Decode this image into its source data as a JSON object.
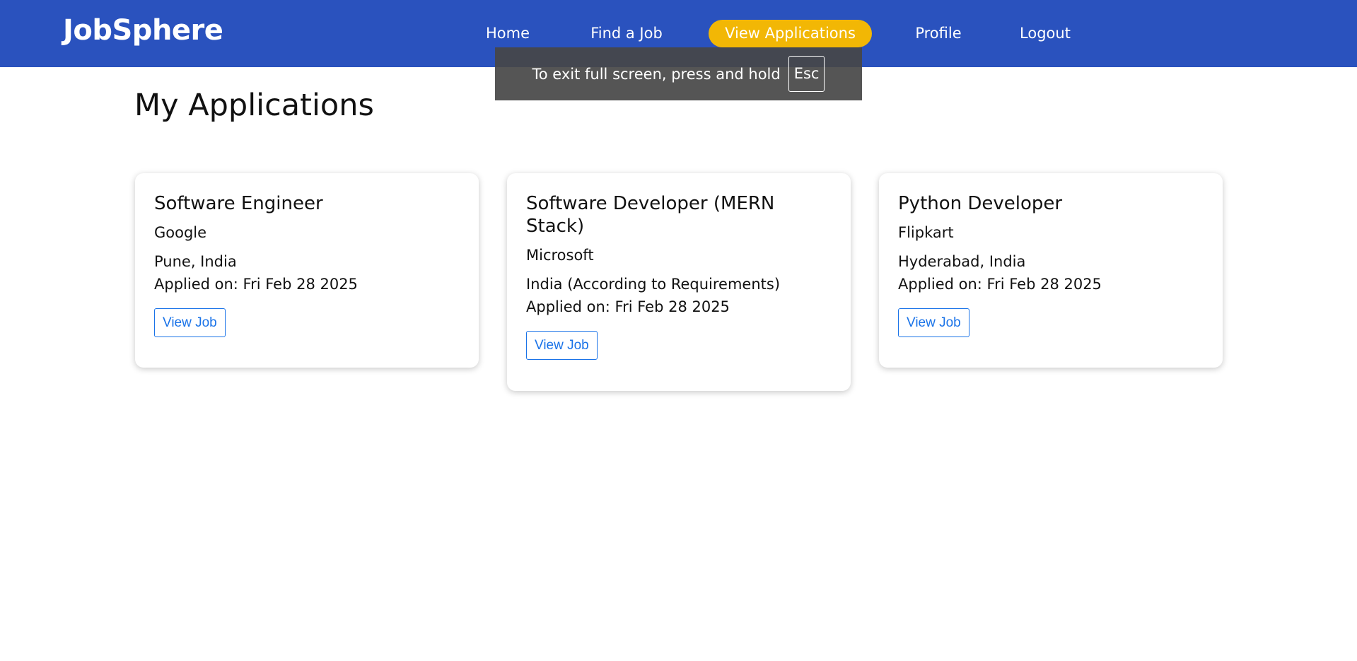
{
  "navbar": {
    "brand": "JobSphere",
    "links": [
      {
        "label": "Home"
      },
      {
        "label": "Find a Job"
      },
      {
        "label": "View Applications",
        "active": true
      },
      {
        "label": "Profile"
      },
      {
        "label": "Logout"
      }
    ],
    "colors": {
      "background": "#2a52be",
      "active_pill": "#f2b705"
    }
  },
  "fullscreen_notice": {
    "message": "To exit full screen, press and hold",
    "key": "Esc"
  },
  "page": {
    "title": "My Applications"
  },
  "applications": [
    {
      "title": "Software Engineer",
      "company": "Google",
      "location": "Pune, India",
      "applied_label": "Applied on:",
      "applied_date": "Fri Feb 28 2025",
      "button_label": "View Job"
    },
    {
      "title": "Software Developer (MERN Stack)",
      "company": "Microsoft",
      "location": "India (According to Requirements)",
      "applied_label": "Applied on:",
      "applied_date": "Fri Feb 28 2025",
      "button_label": "View Job"
    },
    {
      "title": "Python Developer",
      "company": "Flipkart",
      "location": "Hyderabad, India",
      "applied_label": "Applied on:",
      "applied_date": "Fri Feb 28 2025",
      "button_label": "View Job"
    }
  ]
}
